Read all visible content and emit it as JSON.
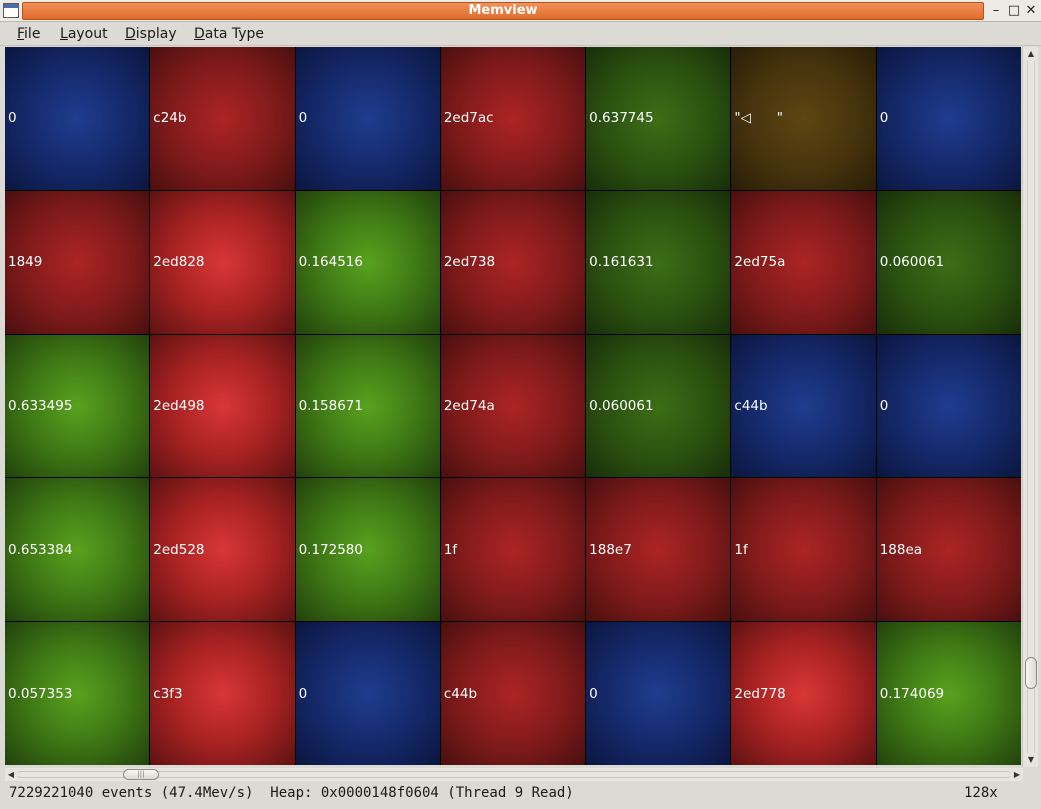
{
  "window": {
    "title": "Memview"
  },
  "menu": {
    "items": [
      {
        "label": "File",
        "accel": "F",
        "rest": "ile"
      },
      {
        "label": "Layout",
        "accel": "L",
        "rest": "ayout"
      },
      {
        "label": "Display",
        "accel": "D",
        "rest": "isplay"
      },
      {
        "label": "Data Type",
        "accel": "D",
        "rest": "ata Type"
      }
    ]
  },
  "grid": {
    "columns": 7,
    "rows": 5,
    "cells": [
      {
        "value": "0",
        "color": "blue"
      },
      {
        "value": "c24b",
        "color": "red"
      },
      {
        "value": "0",
        "color": "blue"
      },
      {
        "value": "2ed7ac",
        "color": "red"
      },
      {
        "value": "0.637745",
        "color": "green"
      },
      {
        "value": "\"◁      \"",
        "color": "brown"
      },
      {
        "value": "0",
        "color": "blue"
      },
      {
        "value": "1849",
        "color": "red"
      },
      {
        "value": "2ed828",
        "color": "red-hi"
      },
      {
        "value": "0.164516",
        "color": "green-hi"
      },
      {
        "value": "2ed738",
        "color": "red"
      },
      {
        "value": "0.161631",
        "color": "green"
      },
      {
        "value": "2ed75a",
        "color": "red"
      },
      {
        "value": "0.060061",
        "color": "green"
      },
      {
        "value": "0.633495",
        "color": "green-hi"
      },
      {
        "value": "2ed498",
        "color": "red-hi"
      },
      {
        "value": "0.158671",
        "color": "green-hi"
      },
      {
        "value": "2ed74a",
        "color": "red"
      },
      {
        "value": "0.060061",
        "color": "green"
      },
      {
        "value": "c44b",
        "color": "blue"
      },
      {
        "value": "0",
        "color": "blue"
      },
      {
        "value": "0.653384",
        "color": "green-hi"
      },
      {
        "value": "2ed528",
        "color": "red-hi"
      },
      {
        "value": "0.172580",
        "color": "green-hi"
      },
      {
        "value": "1f",
        "color": "red"
      },
      {
        "value": "188e7",
        "color": "red"
      },
      {
        "value": "1f",
        "color": "red"
      },
      {
        "value": "188ea",
        "color": "red"
      },
      {
        "value": "0.057353",
        "color": "green-hi"
      },
      {
        "value": "c3f3",
        "color": "red-hi"
      },
      {
        "value": "0",
        "color": "blue"
      },
      {
        "value": "c44b",
        "color": "red"
      },
      {
        "value": "0",
        "color": "blue"
      },
      {
        "value": "2ed778",
        "color": "red-hi"
      },
      {
        "value": "0.174069",
        "color": "green-hi"
      }
    ]
  },
  "status": {
    "text": "7229221040 events (47.4Mev/s)  Heap: 0x0000148f0604 (Thread 9 Read)",
    "zoom": "128x"
  }
}
